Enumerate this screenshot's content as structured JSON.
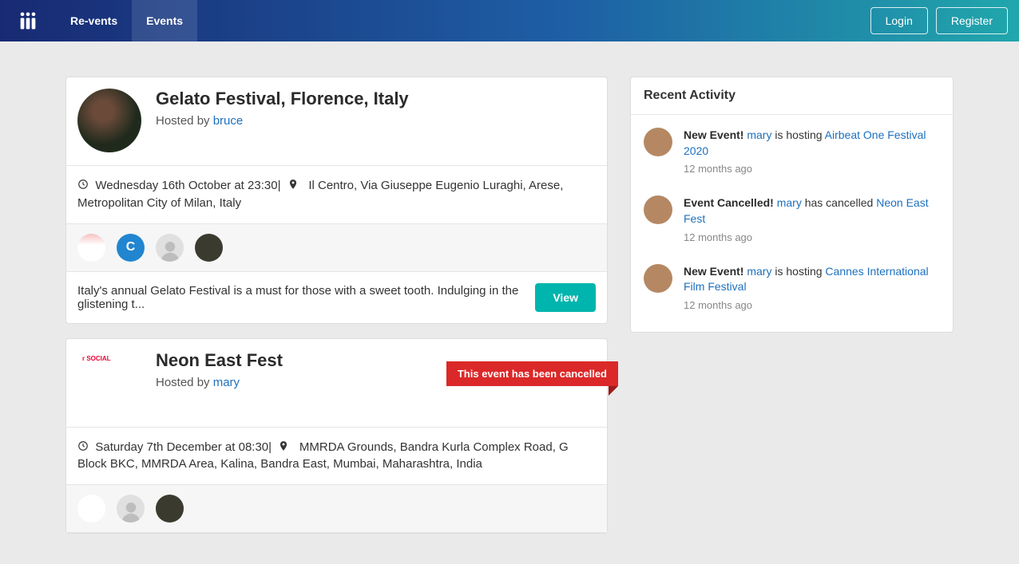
{
  "nav": {
    "brand": "Re-vents",
    "events": "Events",
    "login": "Login",
    "register": "Register"
  },
  "events": [
    {
      "title": "Gelato Festival, Florence, Italy",
      "hosted_by_prefix": "Hosted by ",
      "host": "bruce",
      "datetime": "Wednesday 16th October at 23:30",
      "location": "Il Centro, Via Giuseppe Eugenio Luraghi, Arese, Metropolitan City of Milan, Italy",
      "description": "Italy's annual Gelato Festival is a must for those with a sweet tooth. Indulging in the glistening t...",
      "view_label": "View",
      "cancelled": false,
      "attendee_letter": "C"
    },
    {
      "title": "Neon East Fest",
      "hosted_by_prefix": "Hosted by ",
      "host": "mary",
      "datetime": "Saturday 7th December at 08:30",
      "location": "MMRDA Grounds, Bandra Kurla Complex Road, G Block BKC, MMRDA Area, Kalina, Bandra East, Mumbai, Maharashtra, India",
      "cancelled": true,
      "cancelled_label": "This event has been cancelled"
    }
  ],
  "sidebar": {
    "title": "Recent Activity",
    "items": [
      {
        "prefix": "New Event! ",
        "user": "mary",
        "mid": " is hosting ",
        "link": "Airbeat One Festival 2020",
        "time": "12 months ago"
      },
      {
        "prefix": "Event Cancelled! ",
        "user": "mary",
        "mid": " has cancelled ",
        "link": "Neon East Fest",
        "time": "12 months ago"
      },
      {
        "prefix": "New Event! ",
        "user": "mary",
        "mid": " is hosting ",
        "link": "Cannes International Film Festival",
        "time": "12 months ago"
      }
    ]
  }
}
